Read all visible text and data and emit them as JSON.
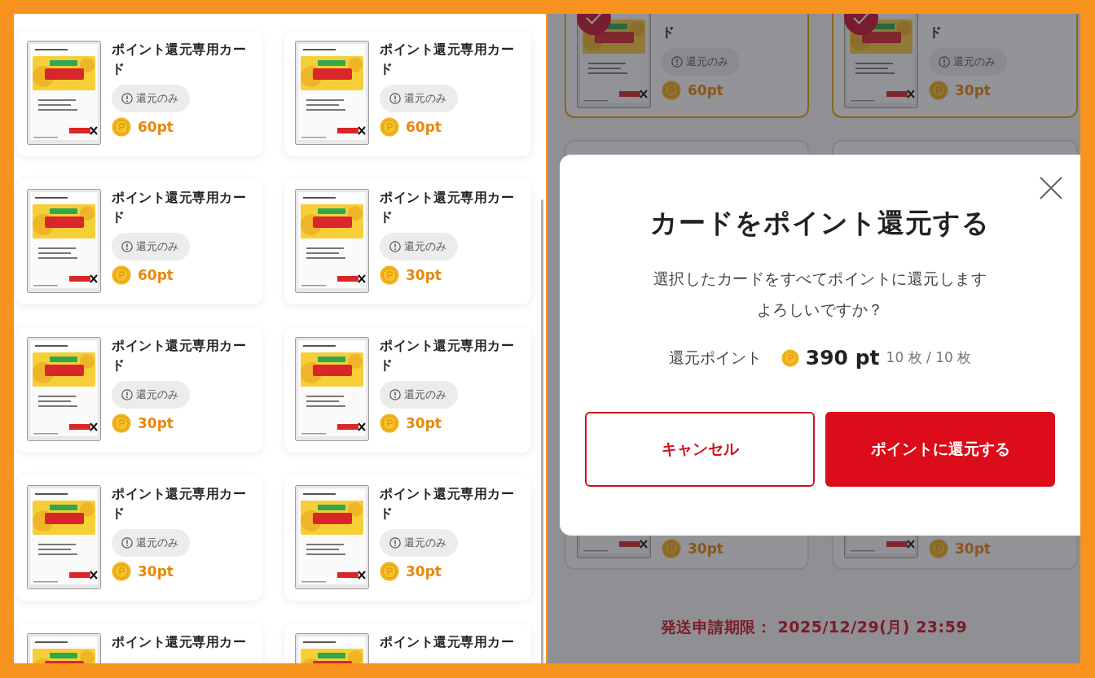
{
  "card_list": {
    "cards": [
      {
        "title": "ポイント還元専用カード",
        "badge": "還元のみ",
        "points": "60pt"
      },
      {
        "title": "ポイント還元専用カード",
        "badge": "還元のみ",
        "points": "60pt"
      },
      {
        "title": "ポイント還元専用カード",
        "badge": "還元のみ",
        "points": "60pt"
      },
      {
        "title": "ポイント還元専用カード",
        "badge": "還元のみ",
        "points": "30pt"
      },
      {
        "title": "ポイント還元専用カード",
        "badge": "還元のみ",
        "points": "30pt"
      },
      {
        "title": "ポイント還元専用カード",
        "badge": "還元のみ",
        "points": "30pt"
      },
      {
        "title": "ポイント還元専用カード",
        "badge": "還元のみ",
        "points": "30pt"
      },
      {
        "title": "ポイント還元専用カード",
        "badge": "還元のみ",
        "points": "30pt"
      },
      {
        "title": "ポイント還元専用カー"
      },
      {
        "title": "ポイント還元専用カー"
      }
    ]
  },
  "background": {
    "top_cards": [
      {
        "title": "ド",
        "badge": "還元のみ",
        "points": "60pt",
        "selected": true
      },
      {
        "title": "ド",
        "badge": "還元のみ",
        "points": "30pt",
        "selected": true
      }
    ],
    "bottom_cards": [
      {
        "points": "30pt"
      },
      {
        "points": "30pt"
      }
    ],
    "deadline": "発送申請期限： 2025/12/29(月) 23:59"
  },
  "dialog": {
    "title": "カードをポイント還元する",
    "message_lines": [
      "選択したカードをすべてポイントに還元します",
      "よろしいですか？"
    ],
    "summary_label": "還元ポイント",
    "total": "390 pt",
    "count": "10 枚 / 10 枚",
    "buttons": [
      {
        "label": "キャンセル",
        "kind": "secondary"
      },
      {
        "label": "ポイントに還元する",
        "kind": "primary"
      }
    ]
  }
}
